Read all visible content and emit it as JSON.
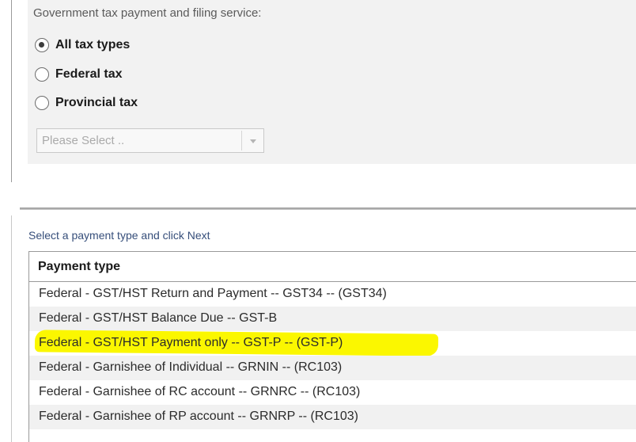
{
  "filter_panel": {
    "title": "Government tax payment and filing service:",
    "radio_options": [
      {
        "label": "All tax types",
        "checked": true
      },
      {
        "label": "Federal tax",
        "checked": false
      },
      {
        "label": "Provincial tax",
        "checked": false
      }
    ],
    "select": {
      "placeholder": "Please Select ..",
      "arrow_icon": "chevron-down-icon"
    }
  },
  "payment_section": {
    "instruction": "Select a payment type and click Next",
    "table": {
      "header": "Payment type",
      "rows": [
        {
          "label": "Federal - GST/HST  Return and Payment -- GST34 -- (GST34)",
          "highlighted": false
        },
        {
          "label": "Federal - GST/HST Balance Due -- GST-B",
          "highlighted": false
        },
        {
          "label": "Federal - GST/HST Payment only -- GST-P -- (GST-P)",
          "highlighted": true
        },
        {
          "label": "Federal - Garnishee of Individual -- GRNIN -- (RC103)",
          "highlighted": false
        },
        {
          "label": "Federal - Garnishee of RC account -- GRNRC -- (RC103)",
          "highlighted": false
        },
        {
          "label": "Federal - Garnishee of RP account -- GRNRP -- (RC103)",
          "highlighted": false
        }
      ]
    }
  },
  "colors": {
    "panel_background": "#f2f2f2",
    "highlight": "#fbf700",
    "instruction_text": "#364e7a",
    "alt_row": "#f1f1f1"
  }
}
